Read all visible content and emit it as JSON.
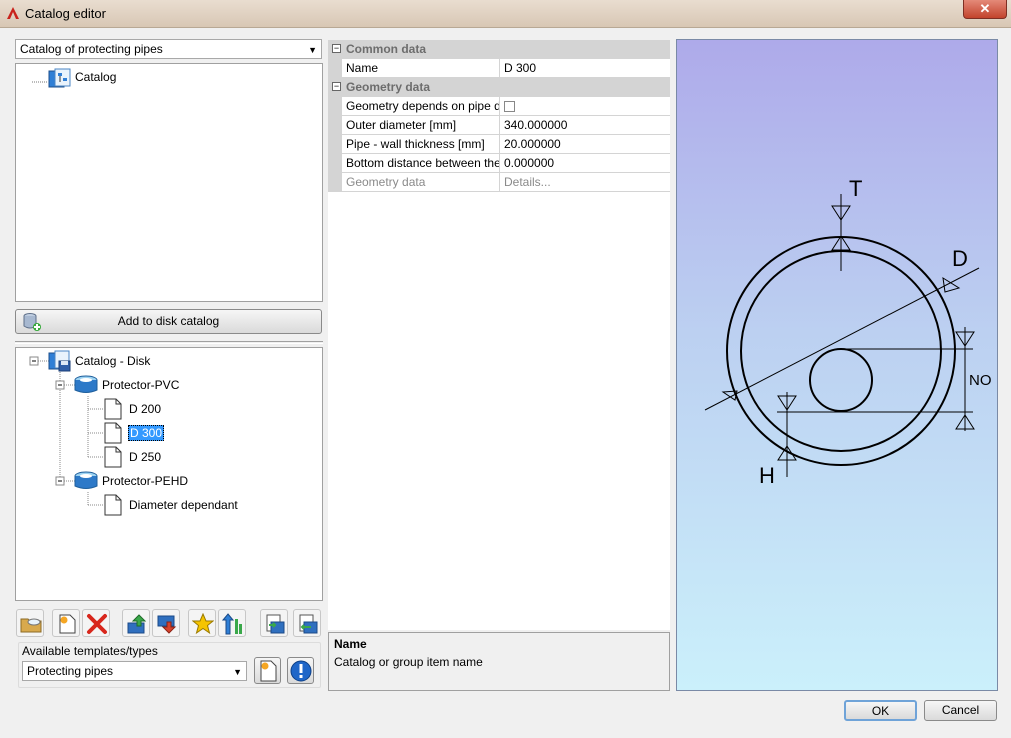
{
  "window": {
    "title": "Catalog editor",
    "close": "✕"
  },
  "catalog_selector": {
    "value": "Catalog of protecting pipes"
  },
  "catalog_tree": {
    "root": "Catalog"
  },
  "add_button": {
    "label": "Add to disk catalog"
  },
  "disk_tree": {
    "root": "Catalog - Disk",
    "groups": [
      {
        "label": "Protector-PVC",
        "items": [
          "D 200",
          "D 300",
          "D 250"
        ]
      },
      {
        "label": "Protector-PEHD",
        "items": [
          "Diameter dependant"
        ]
      }
    ],
    "selected": "D 300"
  },
  "templates": {
    "label": "Available templates/types",
    "value": "Protecting pipes"
  },
  "properties": {
    "common": {
      "header": "Common data",
      "rows": [
        {
          "key": "Name",
          "value": "D 300"
        }
      ]
    },
    "geometry": {
      "header": "Geometry data",
      "rows": [
        {
          "key": "Geometry depends on pipe d",
          "value": ""
        },
        {
          "key": "Outer diameter [mm]",
          "value": "340.000000"
        },
        {
          "key": "Pipe - wall thickness [mm]",
          "value": "20.000000"
        },
        {
          "key": "Bottom distance between the",
          "value": "0.000000"
        },
        {
          "key": "Geometry data",
          "value": "Details..."
        }
      ]
    }
  },
  "description": {
    "title": "Name",
    "text": "Catalog or group item name"
  },
  "diagram": {
    "labels": {
      "t": "T",
      "d": "D",
      "no": "NO",
      "h": "H"
    }
  },
  "buttons": {
    "ok": "OK",
    "cancel": "Cancel"
  },
  "icons": [
    "app-logo-icon",
    "new-folder-icon",
    "new-item-icon",
    "delete-icon",
    "move-up-icon",
    "move-down-icon",
    "favorite-icon",
    "sort-icon",
    "import-icon",
    "export-icon",
    "new-template-icon",
    "info-icon"
  ]
}
